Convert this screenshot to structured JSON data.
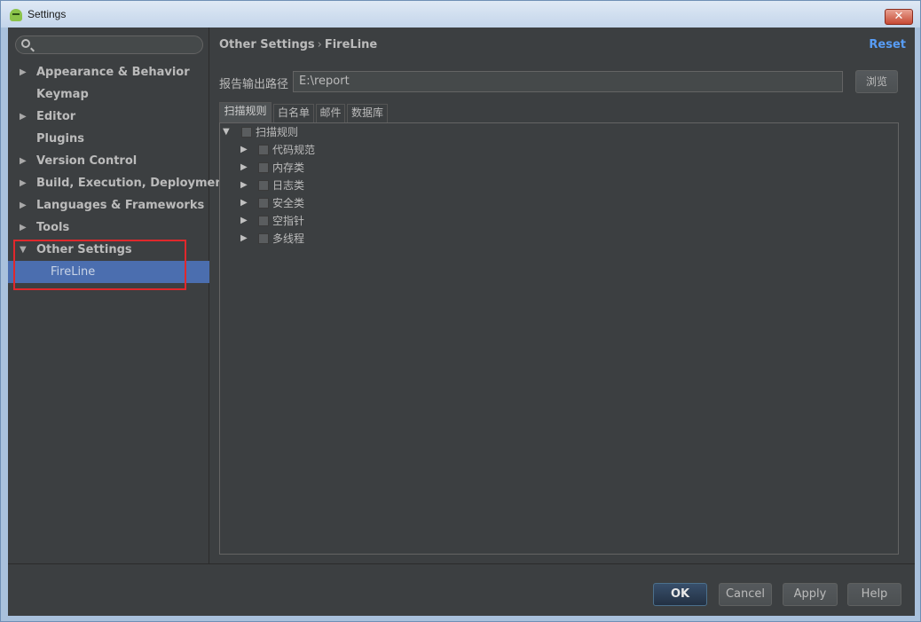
{
  "window": {
    "title": "Settings",
    "close_glyph": "✕"
  },
  "sidebar": {
    "search_placeholder": "",
    "items": [
      {
        "label": "Appearance & Behavior",
        "arrow": "▶"
      },
      {
        "label": "Keymap",
        "arrow": ""
      },
      {
        "label": "Editor",
        "arrow": "▶"
      },
      {
        "label": "Plugins",
        "arrow": ""
      },
      {
        "label": "Version Control",
        "arrow": "▶"
      },
      {
        "label": "Build, Execution, Deployment",
        "arrow": "▶"
      },
      {
        "label": "Languages & Frameworks",
        "arrow": "▶"
      },
      {
        "label": "Tools",
        "arrow": "▶"
      },
      {
        "label": "Other Settings",
        "arrow": "▼"
      },
      {
        "label": "FireLine",
        "arrow": ""
      }
    ]
  },
  "main": {
    "breadcrumb": {
      "parent": "Other Settings",
      "sep": "›",
      "current": "FireLine"
    },
    "reset_label": "Reset",
    "path_label": "报告输出路径",
    "path_value": "E:\\report",
    "browse_label": "浏览",
    "tabs": [
      "扫描规则",
      "白名单",
      "邮件",
      "数据库"
    ],
    "tree": {
      "root": {
        "label": "扫描规则",
        "arrow": "▼"
      },
      "children": [
        {
          "label": "代码规范",
          "arrow": "▶"
        },
        {
          "label": "内存类",
          "arrow": "▶"
        },
        {
          "label": "日志类",
          "arrow": "▶"
        },
        {
          "label": "安全类",
          "arrow": "▶"
        },
        {
          "label": "空指针",
          "arrow": "▶"
        },
        {
          "label": "多线程",
          "arrow": "▶"
        }
      ]
    }
  },
  "footer": {
    "ok": "OK",
    "cancel": "Cancel",
    "apply": "Apply",
    "help": "Help"
  },
  "colors": {
    "accent": "#4b6eaf",
    "link": "#589df6",
    "highlight_box": "#e0282c",
    "background": "#3c3f41"
  }
}
